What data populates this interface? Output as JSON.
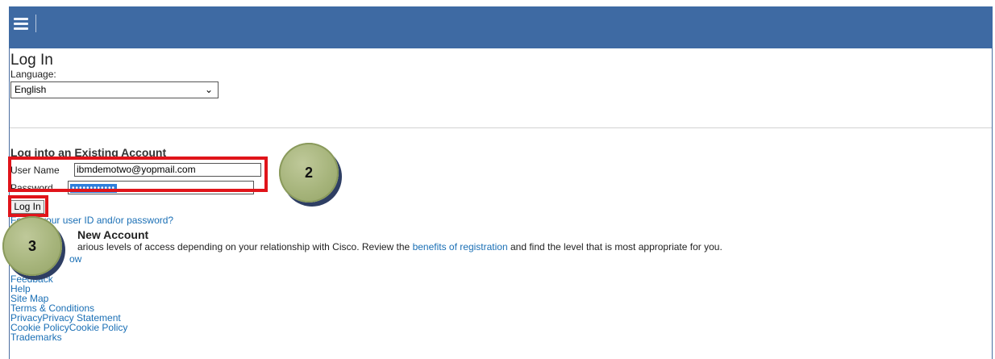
{
  "header": {
    "menu_icon": "hamburger-menu-icon"
  },
  "page": {
    "title": "Log In",
    "language_label": "Language:",
    "language_value": "English"
  },
  "login": {
    "section_title": "Log into an Existing Account",
    "username_label": "User Name",
    "username_value": "ibmdemotwo@yopmail.com",
    "password_label": "Password",
    "password_value": "••••••••••••",
    "login_button": "Log In",
    "forgot_link": "Forgot your user ID and/or password?"
  },
  "register": {
    "title": "New Account",
    "desc_start": "arious levels of access depending on your relationship with Cisco. Review the ",
    "desc_link": "benefits of registration",
    "desc_end": " and find the level that is most appropriate for you.",
    "register_link": "ow"
  },
  "footer": {
    "links": [
      "Feedback",
      "Help",
      "Site Map",
      "Terms & Conditions",
      "PrivacyPrivacy Statement",
      "Cookie PolicyCookie Policy",
      "Trademarks"
    ]
  },
  "callouts": {
    "step2": "2",
    "step3": "3"
  },
  "colors": {
    "header": "#3e6aa3",
    "highlight": "#e0141a",
    "callout": "#a6b47b",
    "link": "#1a6fb5"
  }
}
